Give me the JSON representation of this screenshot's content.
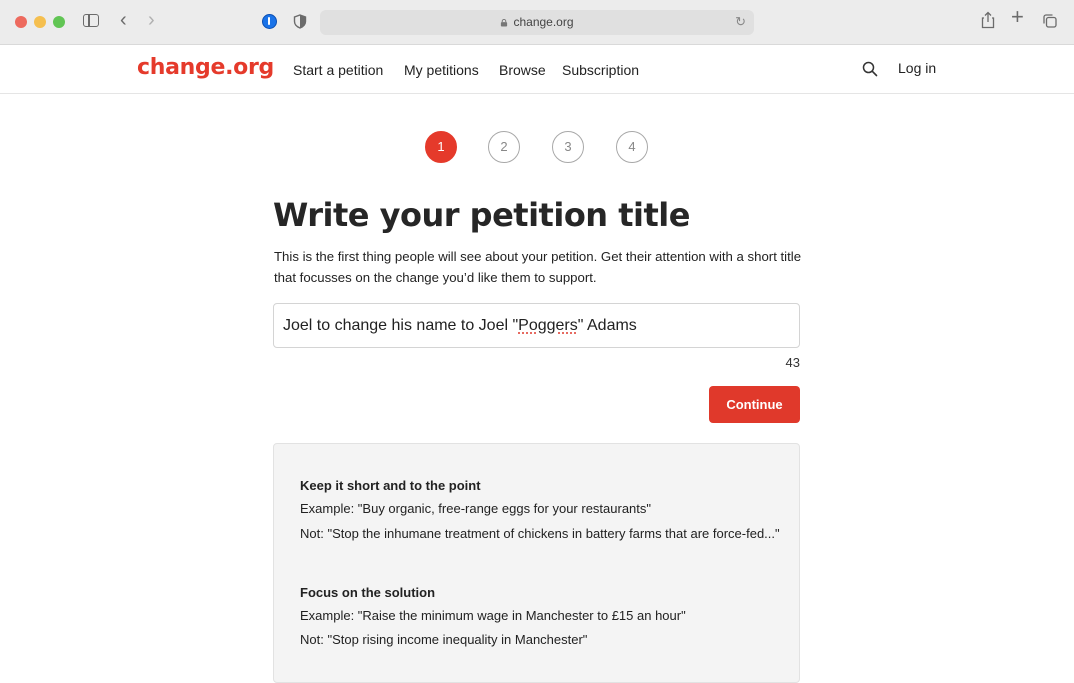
{
  "browser": {
    "url": "change.org"
  },
  "header": {
    "logo": "change.org",
    "nav": [
      {
        "label": "Start a petition"
      },
      {
        "label": "My petitions"
      },
      {
        "label": "Browse"
      },
      {
        "label": "Subscription"
      }
    ],
    "login": "Log in"
  },
  "steps": [
    {
      "label": "1",
      "active": true
    },
    {
      "label": "2",
      "active": false
    },
    {
      "label": "3",
      "active": false
    },
    {
      "label": "4",
      "active": false
    }
  ],
  "form": {
    "heading": "Write your petition title",
    "description": "This is the first thing people will see about your petition. Get their attention with a short title that focusses on the change you’d like them to support.",
    "title_value_before": "Joel to change his name to Joel \"",
    "title_value_misspelled": "Poggers",
    "title_value_after": "\" Adams",
    "char_count": "43",
    "continue_label": "Continue"
  },
  "tips": [
    {
      "heading": "Keep it short and to the point",
      "example": "Example: \"Buy organic, free-range eggs for your restaurants\"",
      "not": "Not: \"Stop the inhumane treatment of chickens in battery farms that are force-fed...\""
    },
    {
      "heading": "Focus on the solution",
      "example": "Example: \"Raise the minimum wage in Manchester to £15 an hour\"",
      "not": "Not: \"Stop rising income inequality in Manchester\""
    }
  ],
  "colors": {
    "brand": "#e53a2b",
    "button": "#e0392b",
    "tips_bg": "#f4f4f4"
  }
}
